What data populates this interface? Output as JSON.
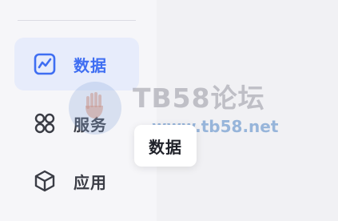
{
  "sidebar": {
    "items": [
      {
        "label": "数据",
        "icon": "line-chart-icon",
        "active": true
      },
      {
        "label": "服务",
        "icon": "grid-circles-icon",
        "active": false
      },
      {
        "label": "应用",
        "icon": "cube-icon",
        "active": false
      }
    ]
  },
  "tooltip": {
    "text": "数据"
  },
  "watermark": {
    "title": "TB58论坛",
    "url": "www.tb58.net"
  },
  "colors": {
    "accent": "#3f6ef2",
    "active_bg": "#e7ecfb",
    "text": "#3a3c45"
  }
}
